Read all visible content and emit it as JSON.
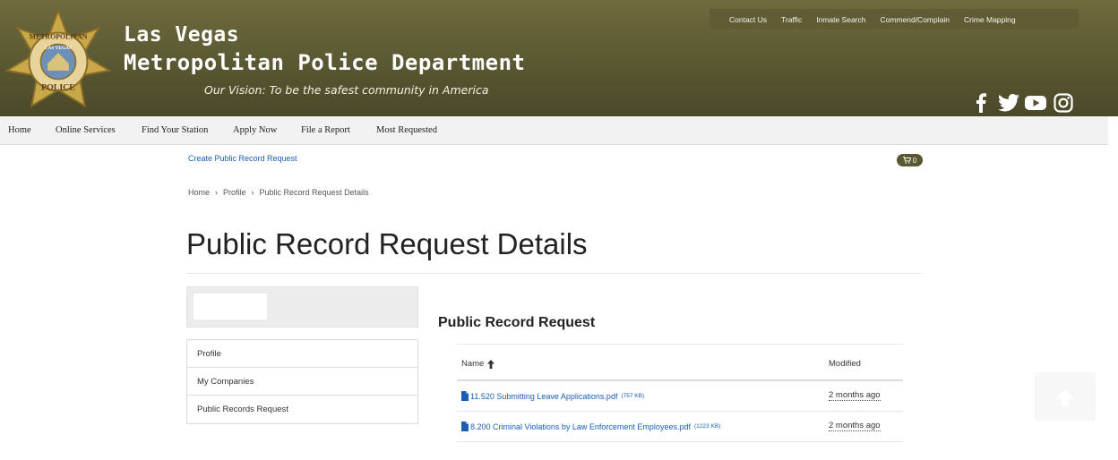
{
  "header": {
    "title_line1": "Las Vegas",
    "title_line2": "Metropolitan Police Department",
    "vision": "Our Vision: To be the safest community in America",
    "badge_text_top": "METROPOLITAN",
    "badge_text_middle": "LAS VEGAS",
    "badge_text_bottom": "POLICE",
    "top_links": [
      "Contact Us",
      "Traffic",
      "Inmate Search",
      "Commend/Complain",
      "Crime Mapping"
    ],
    "social_icons": [
      "facebook-icon",
      "twitter-icon",
      "youtube-icon",
      "instagram-icon"
    ]
  },
  "nav": {
    "items": [
      "Home",
      "Online Services",
      "Find Your Station",
      "Apply Now",
      "File a Report",
      "Most Requested"
    ]
  },
  "create_link": "Create Public Record Request",
  "cart": {
    "count": "0",
    "icon": "cart-icon"
  },
  "breadcrumb": {
    "items": [
      "Home",
      "Profile",
      "Public Record Request Details"
    ],
    "separator": "›"
  },
  "page_title": "Public Record Request Details",
  "sidebar": {
    "items": [
      "Profile",
      "My Companies",
      "Public Records Request"
    ]
  },
  "section_title": "Public Record Request",
  "table": {
    "columns": {
      "name": "Name",
      "modified": "Modified"
    },
    "rows": [
      {
        "name": "11.520 Submitting Leave Applications.pdf",
        "size": "(757 KB)",
        "modified": "2 months ago"
      },
      {
        "name": "8.200 Criminal Violations by Law Enforcement Employees.pdf",
        "size": "(1223 KB)",
        "modified": "2 months ago"
      }
    ]
  },
  "colors": {
    "header_bg": "#5a5832",
    "link": "#1a5fb4",
    "nav_bg": "#f2f2f2"
  }
}
